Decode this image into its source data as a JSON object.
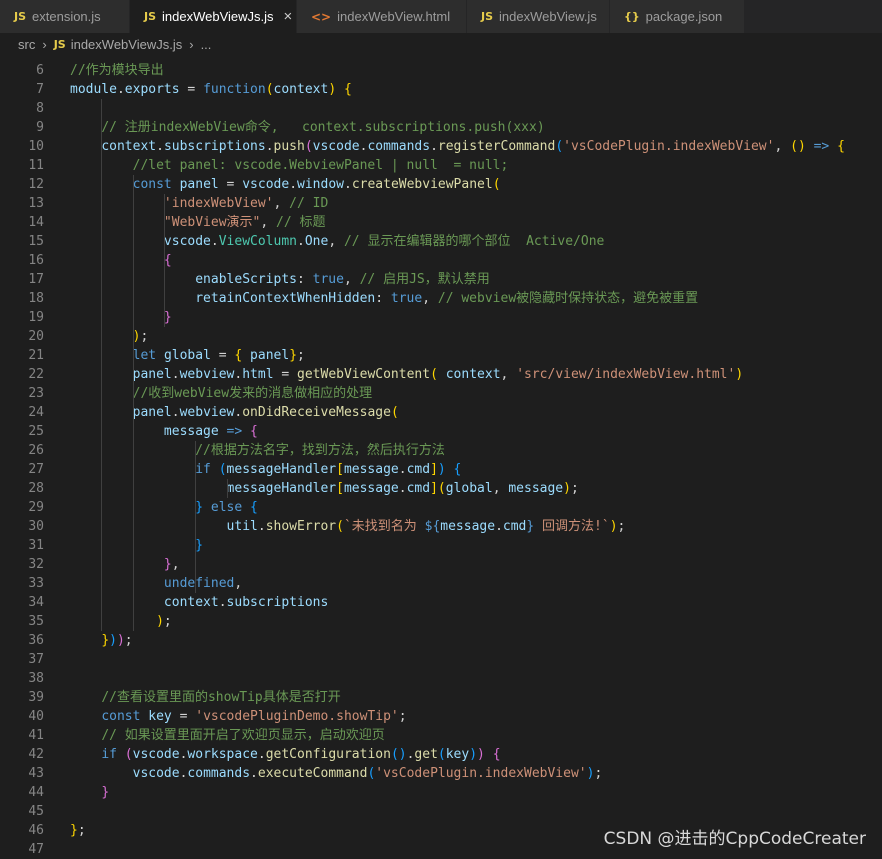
{
  "tabs": [
    {
      "icon": "JS",
      "label": "extension.js",
      "active": false
    },
    {
      "icon": "JS",
      "label": "indexWebViewJs.js",
      "active": true
    },
    {
      "icon": "<>",
      "label": "indexWebView.html",
      "active": false
    },
    {
      "icon": "JS",
      "label": "indexWebView.js",
      "active": false
    },
    {
      "icon": "{}",
      "label": "package.json",
      "active": false
    }
  ],
  "breadcrumb": {
    "folder": "src",
    "icon": "JS",
    "file": "indexWebViewJs.js",
    "more": "..."
  },
  "watermark": "CSDN @进击的CppCodeCreater",
  "lines": [
    {
      "n": "6",
      "tokens": [
        [
          "c",
          "//作为模块导出"
        ]
      ]
    },
    {
      "n": "7",
      "tokens": [
        [
          "v",
          "module"
        ],
        [
          "",
          "."
        ],
        [
          "v",
          "exports"
        ],
        [
          "",
          " = "
        ],
        [
          "k",
          "function"
        ],
        [
          "p1",
          "("
        ],
        [
          "v",
          "context"
        ],
        [
          "p1",
          ")"
        ],
        [
          "",
          " "
        ],
        [
          "p1",
          "{"
        ]
      ]
    },
    {
      "n": "8",
      "tokens": []
    },
    {
      "n": "9",
      "tokens": [
        [
          "",
          "    "
        ],
        [
          "c",
          "// 注册indexWebView命令,   context.subscriptions.push(xxx)"
        ]
      ]
    },
    {
      "n": "10",
      "tokens": [
        [
          "",
          "    "
        ],
        [
          "v",
          "context"
        ],
        [
          "",
          "."
        ],
        [
          "v",
          "subscriptions"
        ],
        [
          "",
          "."
        ],
        [
          "f",
          "push"
        ],
        [
          "p2",
          "("
        ],
        [
          "v",
          "vscode"
        ],
        [
          "",
          "."
        ],
        [
          "v",
          "commands"
        ],
        [
          "",
          "."
        ],
        [
          "f",
          "registerCommand"
        ],
        [
          "p3",
          "("
        ],
        [
          "s",
          "'vsCodePlugin.indexWebView'"
        ],
        [
          "",
          ", "
        ],
        [
          "p1",
          "()"
        ],
        [
          "",
          " "
        ],
        [
          "k",
          "=>"
        ],
        [
          "",
          " "
        ],
        [
          "p1",
          "{"
        ]
      ]
    },
    {
      "n": "11",
      "tokens": [
        [
          "",
          "        "
        ],
        [
          "c",
          "//let panel: vscode.WebviewPanel | null  = null;"
        ]
      ]
    },
    {
      "n": "12",
      "tokens": [
        [
          "",
          "        "
        ],
        [
          "k",
          "const"
        ],
        [
          "",
          " "
        ],
        [
          "v",
          "panel"
        ],
        [
          "",
          " = "
        ],
        [
          "v",
          "vscode"
        ],
        [
          "",
          "."
        ],
        [
          "v",
          "window"
        ],
        [
          "",
          "."
        ],
        [
          "f",
          "createWebviewPanel"
        ],
        [
          "p1",
          "("
        ]
      ]
    },
    {
      "n": "13",
      "tokens": [
        [
          "",
          "            "
        ],
        [
          "s",
          "'indexWebView'"
        ],
        [
          "",
          ", "
        ],
        [
          "c",
          "// ID"
        ]
      ]
    },
    {
      "n": "14",
      "tokens": [
        [
          "",
          "            "
        ],
        [
          "s",
          "\"WebView演示\""
        ],
        [
          "",
          ", "
        ],
        [
          "c",
          "// 标题"
        ]
      ]
    },
    {
      "n": "15",
      "tokens": [
        [
          "",
          "            "
        ],
        [
          "v",
          "vscode"
        ],
        [
          "",
          "."
        ],
        [
          "t",
          "ViewColumn"
        ],
        [
          "",
          "."
        ],
        [
          "v",
          "One"
        ],
        [
          "",
          ", "
        ],
        [
          "c",
          "// 显示在编辑器的哪个部位  Active/One"
        ]
      ]
    },
    {
      "n": "16",
      "tokens": [
        [
          "",
          "            "
        ],
        [
          "p2",
          "{"
        ]
      ]
    },
    {
      "n": "17",
      "tokens": [
        [
          "",
          "                "
        ],
        [
          "v",
          "enableScripts"
        ],
        [
          "",
          ": "
        ],
        [
          "k",
          "true"
        ],
        [
          "",
          ", "
        ],
        [
          "c",
          "// 启用JS，默认禁用"
        ]
      ]
    },
    {
      "n": "18",
      "tokens": [
        [
          "",
          "                "
        ],
        [
          "v",
          "retainContextWhenHidden"
        ],
        [
          "",
          ": "
        ],
        [
          "k",
          "true"
        ],
        [
          "",
          ", "
        ],
        [
          "c",
          "// webview被隐藏时保持状态，避免被重置"
        ]
      ]
    },
    {
      "n": "19",
      "tokens": [
        [
          "",
          "            "
        ],
        [
          "p2",
          "}"
        ]
      ]
    },
    {
      "n": "20",
      "tokens": [
        [
          "",
          "        "
        ],
        [
          "p1",
          ")"
        ],
        [
          "",
          ";"
        ]
      ]
    },
    {
      "n": "21",
      "tokens": [
        [
          "",
          "        "
        ],
        [
          "k",
          "let"
        ],
        [
          "",
          " "
        ],
        [
          "v",
          "global"
        ],
        [
          "",
          " = "
        ],
        [
          "p1",
          "{"
        ],
        [
          "",
          " "
        ],
        [
          "v",
          "panel"
        ],
        [
          "p1",
          "}"
        ],
        [
          "",
          ";"
        ]
      ]
    },
    {
      "n": "22",
      "tokens": [
        [
          "",
          "        "
        ],
        [
          "v",
          "panel"
        ],
        [
          "",
          "."
        ],
        [
          "v",
          "webview"
        ],
        [
          "",
          "."
        ],
        [
          "v",
          "html"
        ],
        [
          "",
          " = "
        ],
        [
          "f",
          "getWebViewContent"
        ],
        [
          "p1",
          "("
        ],
        [
          "",
          " "
        ],
        [
          "v",
          "context"
        ],
        [
          "",
          ", "
        ],
        [
          "s",
          "'src/view/indexWebView.html'"
        ],
        [
          "p1",
          ")"
        ]
      ]
    },
    {
      "n": "23",
      "tokens": [
        [
          "",
          "        "
        ],
        [
          "c",
          "//收到webView发来的消息做相应的处理"
        ]
      ]
    },
    {
      "n": "24",
      "tokens": [
        [
          "",
          "        "
        ],
        [
          "v",
          "panel"
        ],
        [
          "",
          "."
        ],
        [
          "v",
          "webview"
        ],
        [
          "",
          "."
        ],
        [
          "f",
          "onDidReceiveMessage"
        ],
        [
          "p1",
          "("
        ]
      ]
    },
    {
      "n": "25",
      "tokens": [
        [
          "",
          "            "
        ],
        [
          "v",
          "message"
        ],
        [
          "",
          " "
        ],
        [
          "k",
          "=>"
        ],
        [
          "",
          " "
        ],
        [
          "p2",
          "{"
        ]
      ]
    },
    {
      "n": "26",
      "tokens": [
        [
          "",
          "                "
        ],
        [
          "c",
          "//根据方法名字，找到方法，然后执行方法"
        ]
      ]
    },
    {
      "n": "27",
      "tokens": [
        [
          "",
          "                "
        ],
        [
          "k",
          "if"
        ],
        [
          "",
          " "
        ],
        [
          "p3",
          "("
        ],
        [
          "v",
          "messageHandler"
        ],
        [
          "p1",
          "["
        ],
        [
          "v",
          "message"
        ],
        [
          "",
          "."
        ],
        [
          "v",
          "cmd"
        ],
        [
          "p1",
          "]"
        ],
        [
          "p3",
          ")"
        ],
        [
          "",
          " "
        ],
        [
          "p3",
          "{"
        ]
      ]
    },
    {
      "n": "28",
      "tokens": [
        [
          "",
          "                    "
        ],
        [
          "v",
          "messageHandler"
        ],
        [
          "p1",
          "["
        ],
        [
          "v",
          "message"
        ],
        [
          "",
          "."
        ],
        [
          "v",
          "cmd"
        ],
        [
          "p1",
          "]"
        ],
        [
          "p1",
          "("
        ],
        [
          "v",
          "global"
        ],
        [
          "",
          ", "
        ],
        [
          "v",
          "message"
        ],
        [
          "p1",
          ")"
        ],
        [
          "",
          ";"
        ]
      ]
    },
    {
      "n": "29",
      "tokens": [
        [
          "",
          "                "
        ],
        [
          "p3",
          "}"
        ],
        [
          "",
          " "
        ],
        [
          "k",
          "else"
        ],
        [
          "",
          " "
        ],
        [
          "p3",
          "{"
        ]
      ]
    },
    {
      "n": "30",
      "tokens": [
        [
          "",
          "                    "
        ],
        [
          "v",
          "util"
        ],
        [
          "",
          "."
        ],
        [
          "f",
          "showError"
        ],
        [
          "p1",
          "("
        ],
        [
          "s",
          "`未找到名为 "
        ],
        [
          "k",
          "${"
        ],
        [
          "v",
          "message"
        ],
        [
          "",
          "."
        ],
        [
          "v",
          "cmd"
        ],
        [
          "k",
          "}"
        ],
        [
          "s",
          " 回调方法!`"
        ],
        [
          "p1",
          ")"
        ],
        [
          "",
          ";"
        ]
      ]
    },
    {
      "n": "31",
      "tokens": [
        [
          "",
          "                "
        ],
        [
          "p3",
          "}"
        ]
      ]
    },
    {
      "n": "32",
      "tokens": [
        [
          "",
          "            "
        ],
        [
          "p2",
          "}"
        ],
        [
          "",
          ","
        ]
      ]
    },
    {
      "n": "33",
      "tokens": [
        [
          "",
          "            "
        ],
        [
          "k",
          "undefined"
        ],
        [
          "",
          ","
        ]
      ]
    },
    {
      "n": "34",
      "tokens": [
        [
          "",
          "            "
        ],
        [
          "v",
          "context"
        ],
        [
          "",
          "."
        ],
        [
          "v",
          "subscriptions"
        ]
      ]
    },
    {
      "n": "35",
      "tokens": [
        [
          "",
          "           "
        ],
        [
          "p1",
          ")"
        ],
        [
          "",
          ";"
        ]
      ]
    },
    {
      "n": "36",
      "tokens": [
        [
          "",
          "    "
        ],
        [
          "p1",
          "}"
        ],
        [
          "p3",
          ")"
        ],
        [
          "p2",
          ")"
        ],
        [
          "",
          ";"
        ]
      ]
    },
    {
      "n": "37",
      "tokens": []
    },
    {
      "n": "38",
      "tokens": []
    },
    {
      "n": "39",
      "tokens": [
        [
          "",
          "    "
        ],
        [
          "c",
          "//查看设置里面的showTip具体是否打开"
        ]
      ]
    },
    {
      "n": "40",
      "tokens": [
        [
          "",
          "    "
        ],
        [
          "k",
          "const"
        ],
        [
          "",
          " "
        ],
        [
          "v",
          "key"
        ],
        [
          "",
          " = "
        ],
        [
          "s",
          "'vscodePluginDemo.showTip'"
        ],
        [
          "",
          ";"
        ]
      ]
    },
    {
      "n": "41",
      "tokens": [
        [
          "",
          "    "
        ],
        [
          "c",
          "// 如果设置里面开启了欢迎页显示，启动欢迎页"
        ]
      ]
    },
    {
      "n": "42",
      "tokens": [
        [
          "",
          "    "
        ],
        [
          "k",
          "if"
        ],
        [
          "",
          " "
        ],
        [
          "p2",
          "("
        ],
        [
          "v",
          "vscode"
        ],
        [
          "",
          "."
        ],
        [
          "v",
          "workspace"
        ],
        [
          "",
          "."
        ],
        [
          "f",
          "getConfiguration"
        ],
        [
          "p3",
          "()"
        ],
        [
          "",
          "."
        ],
        [
          "f",
          "get"
        ],
        [
          "p3",
          "("
        ],
        [
          "v",
          "key"
        ],
        [
          "p3",
          ")"
        ],
        [
          "p2",
          ")"
        ],
        [
          "",
          " "
        ],
        [
          "p2",
          "{"
        ]
      ]
    },
    {
      "n": "43",
      "tokens": [
        [
          "",
          "        "
        ],
        [
          "v",
          "vscode"
        ],
        [
          "",
          "."
        ],
        [
          "v",
          "commands"
        ],
        [
          "",
          "."
        ],
        [
          "f",
          "executeCommand"
        ],
        [
          "p3",
          "("
        ],
        [
          "s",
          "'vsCodePlugin.indexWebView'"
        ],
        [
          "p3",
          ")"
        ],
        [
          "",
          ";"
        ]
      ]
    },
    {
      "n": "44",
      "tokens": [
        [
          "",
          "    "
        ],
        [
          "p2",
          "}"
        ]
      ]
    },
    {
      "n": "45",
      "tokens": []
    },
    {
      "n": "46",
      "tokens": [
        [
          "p1",
          "}"
        ],
        [
          "",
          ";"
        ]
      ]
    },
    {
      "n": "47",
      "tokens": []
    }
  ]
}
